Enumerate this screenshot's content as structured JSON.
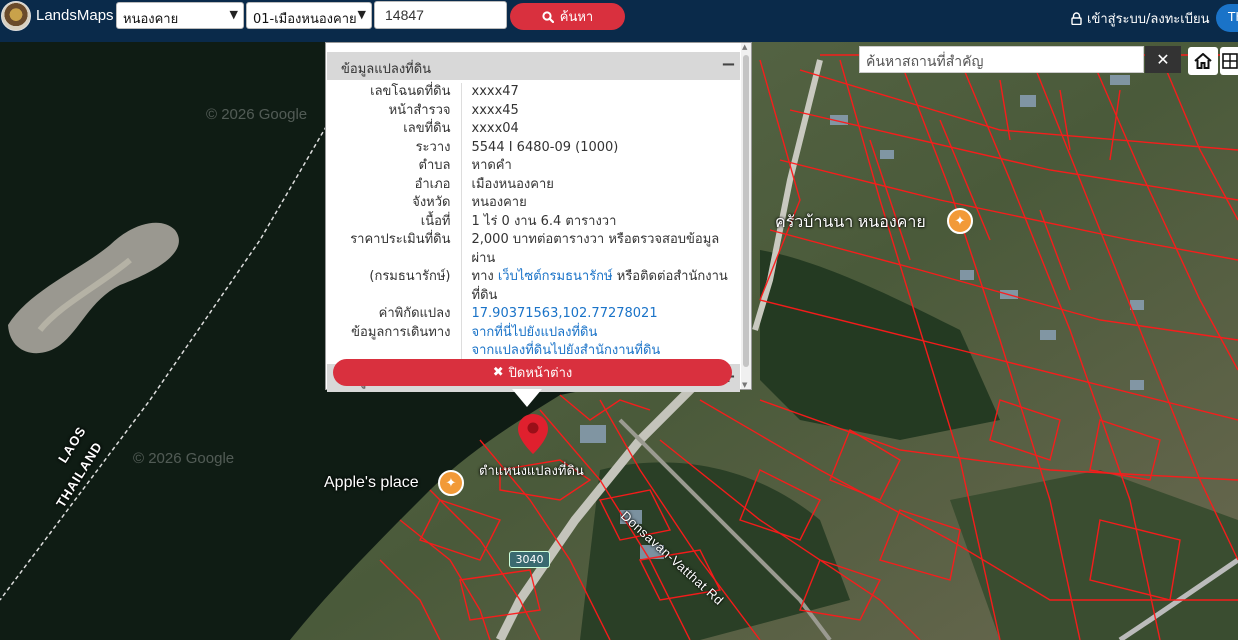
{
  "brand": "LandsMaps",
  "province_select": {
    "value": "หนองคาย"
  },
  "district_select": {
    "value": "01-เมืองหนองคาย"
  },
  "parcel_input": {
    "value": "14847"
  },
  "search_button": {
    "label": "ค้นหา"
  },
  "login_link": {
    "label": "เข้าสู่ระบบ/ลงทะเบียน"
  },
  "language_button": {
    "label": "TH"
  },
  "place_search": {
    "placeholder": "ค้นหาสถานที่สำคัญ"
  },
  "popup": {
    "panel1_title": "ข้อมูลแปลงที่ดิน",
    "panel1_toggle": "−",
    "rows": [
      {
        "key": "เลขโฉนดที่ดิน",
        "value": "xxxx47"
      },
      {
        "key": "หน้าสำรวจ",
        "value": "xxxx45"
      },
      {
        "key": "เลขที่ดิน",
        "value": "xxxx04"
      },
      {
        "key": "ระวาง",
        "value": "5544 I 6480-09 (1000)"
      },
      {
        "key": "ตำบล",
        "value": "หาดคำ"
      },
      {
        "key": "อำเภอ",
        "value": "เมืองหนองคาย"
      },
      {
        "key": "จังหวัด",
        "value": "หนองคาย"
      },
      {
        "key": "เนื้อที่",
        "value": "1 ไร่ 0 งาน 6.4 ตารางวา"
      }
    ],
    "price_key_1": "ราคาประเมินที่ดิน",
    "price_key_2": "(กรมธนารักษ์)",
    "price_text_1": "2,000 บาทต่อตารางวา หรือตรวจสอบข้อมูลผ่าน",
    "price_text_2a": "ทาง ",
    "price_link": "เว็บไซต์กรมธนารักษ์",
    "price_text_2b": " หรือติดต่อสำนักงานที่ดิน",
    "coord_key": "ค่าพิกัดแปลง",
    "coord_value": "17.90371563,102.77278021",
    "directions_key": "ข้อมูลการเดินทาง",
    "directions_link_1": "จากที่นี่ไปยังแปลงที่ดิน",
    "directions_link_2": "จากแปลงที่ดินไปยังสำนักงานที่ดิน",
    "panel2_title": "ข้อมูลสำนักงานที่ดิน",
    "panel2_toggle": "+",
    "close_label": "ปิดหน้าต่าง"
  },
  "map": {
    "restaurant_label": "ครัวบ้านนา หนองคาย",
    "apples_place_label": "Apple's place",
    "parcel_marker_label": "ตำแหน่งแปลงที่ดิน",
    "road_label": "Donsavan-Vatthat Rd",
    "border_label_1": "LAOS",
    "border_label_2": "THAILAND",
    "route_number": "3040",
    "watermark": "© 2026 Google"
  },
  "colors": {
    "topbar": "#0a2a4a",
    "accent_red": "#d9303e",
    "link_blue": "#1a73c8",
    "parcel_line": "#ff1a1a",
    "poi_orange": "#f29a38"
  }
}
